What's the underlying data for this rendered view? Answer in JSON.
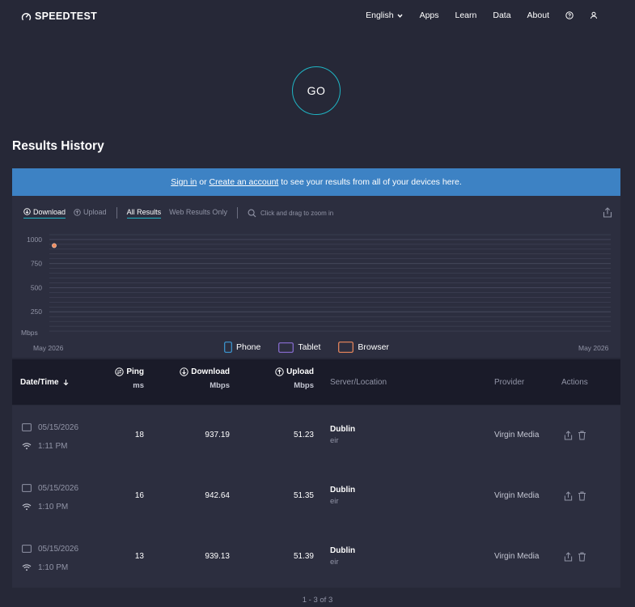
{
  "nav": {
    "logo_text": "SPEEDTEST",
    "language": "English",
    "links": [
      "Apps",
      "Learn",
      "Data",
      "About"
    ],
    "help_icon": "help-circle-icon",
    "user_icon": "user-icon"
  },
  "go_label": "GO",
  "results_title": "Results History",
  "banner": {
    "sign_in": "Sign in",
    "or": " or ",
    "create_account": "Create an account",
    "rest": " to see your results from all of your devices here."
  },
  "chart_controls": {
    "download": "Download",
    "upload": "Upload",
    "all_results": "All Results",
    "web_only": "Web Results Only",
    "zoom_hint": "Click and drag to zoom in"
  },
  "chart_data": {
    "type": "scatter",
    "title": "",
    "xlabel": "",
    "ylabel": "Mbps",
    "x_tick_labels": [
      "May 2026",
      "May 2026"
    ],
    "y_ticks": [
      1000,
      750,
      500,
      250
    ],
    "ylim": [
      0,
      1050
    ],
    "grid": true,
    "series": [
      {
        "name": "Browser",
        "points": [
          {
            "x": "05/15/2026 1:11 PM",
            "y": 937.19
          }
        ]
      }
    ],
    "legend": [
      "Phone",
      "Tablet",
      "Browser"
    ],
    "legend_position": "bottom-center",
    "colors": {
      "point": "#f08a5d",
      "phone": "#3d9ad6",
      "tablet": "#8b6fd6",
      "browser": "#f08a5d",
      "grid": "#474a5e"
    }
  },
  "table": {
    "headers": {
      "datetime": "Date/Time",
      "ping": "Ping",
      "ping_unit": "ms",
      "download": "Download",
      "download_unit": "Mbps",
      "upload": "Upload",
      "upload_unit": "Mbps",
      "server": "Server/Location",
      "provider": "Provider",
      "actions": "Actions"
    },
    "rows": [
      {
        "date": "05/15/2026",
        "time": "1:11 PM",
        "ping": "18",
        "download": "937.19",
        "upload": "51.23",
        "city": "Dublin",
        "isp": "eir",
        "provider": "Virgin Media"
      },
      {
        "date": "05/15/2026",
        "time": "1:10 PM",
        "ping": "16",
        "download": "942.64",
        "upload": "51.35",
        "city": "Dublin",
        "isp": "eir",
        "provider": "Virgin Media"
      },
      {
        "date": "05/15/2026",
        "time": "1:10 PM",
        "ping": "13",
        "download": "939.13",
        "upload": "51.39",
        "city": "Dublin",
        "isp": "eir",
        "provider": "Virgin Media"
      }
    ]
  },
  "pagination": "1 - 3 of 3"
}
